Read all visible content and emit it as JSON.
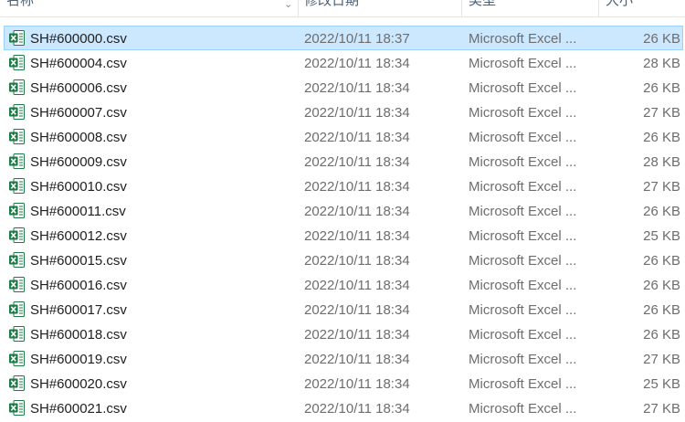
{
  "columns": {
    "name": "名称",
    "date": "修改日期",
    "type": "类型",
    "size": "大小"
  },
  "colors": {
    "selection": "#cce8ff",
    "selection_border": "#99d1ff",
    "excel_green": "#1d7a45"
  },
  "files": [
    {
      "name": "SH#600000.csv",
      "date": "2022/10/11 18:37",
      "type": "Microsoft Excel ...",
      "size": "26 KB",
      "selected": true
    },
    {
      "name": "SH#600004.csv",
      "date": "2022/10/11 18:34",
      "type": "Microsoft Excel ...",
      "size": "28 KB"
    },
    {
      "name": "SH#600006.csv",
      "date": "2022/10/11 18:34",
      "type": "Microsoft Excel ...",
      "size": "26 KB"
    },
    {
      "name": "SH#600007.csv",
      "date": "2022/10/11 18:34",
      "type": "Microsoft Excel ...",
      "size": "27 KB"
    },
    {
      "name": "SH#600008.csv",
      "date": "2022/10/11 18:34",
      "type": "Microsoft Excel ...",
      "size": "26 KB"
    },
    {
      "name": "SH#600009.csv",
      "date": "2022/10/11 18:34",
      "type": "Microsoft Excel ...",
      "size": "28 KB"
    },
    {
      "name": "SH#600010.csv",
      "date": "2022/10/11 18:34",
      "type": "Microsoft Excel ...",
      "size": "27 KB"
    },
    {
      "name": "SH#600011.csv",
      "date": "2022/10/11 18:34",
      "type": "Microsoft Excel ...",
      "size": "26 KB"
    },
    {
      "name": "SH#600012.csv",
      "date": "2022/10/11 18:34",
      "type": "Microsoft Excel ...",
      "size": "25 KB"
    },
    {
      "name": "SH#600015.csv",
      "date": "2022/10/11 18:34",
      "type": "Microsoft Excel ...",
      "size": "26 KB"
    },
    {
      "name": "SH#600016.csv",
      "date": "2022/10/11 18:34",
      "type": "Microsoft Excel ...",
      "size": "26 KB"
    },
    {
      "name": "SH#600017.csv",
      "date": "2022/10/11 18:34",
      "type": "Microsoft Excel ...",
      "size": "26 KB"
    },
    {
      "name": "SH#600018.csv",
      "date": "2022/10/11 18:34",
      "type": "Microsoft Excel ...",
      "size": "26 KB"
    },
    {
      "name": "SH#600019.csv",
      "date": "2022/10/11 18:34",
      "type": "Microsoft Excel ...",
      "size": "27 KB"
    },
    {
      "name": "SH#600020.csv",
      "date": "2022/10/11 18:34",
      "type": "Microsoft Excel ...",
      "size": "25 KB"
    },
    {
      "name": "SH#600021.csv",
      "date": "2022/10/11 18:34",
      "type": "Microsoft Excel ...",
      "size": "27 KB"
    }
  ]
}
